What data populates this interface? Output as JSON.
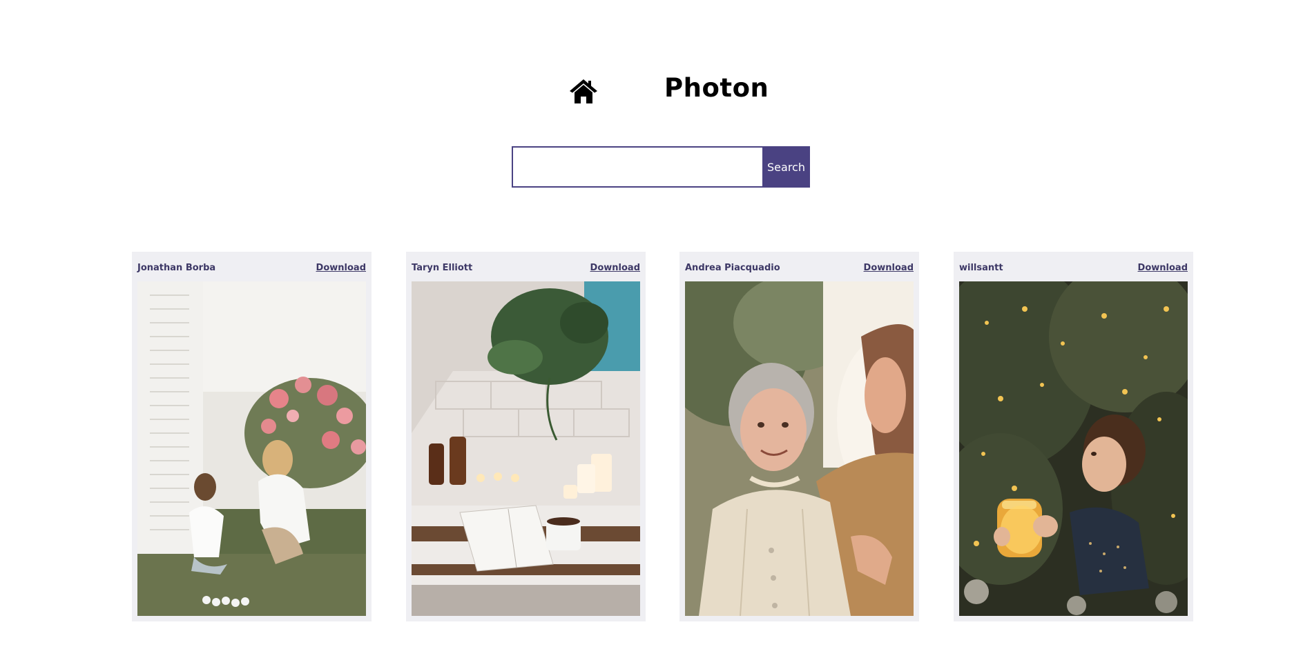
{
  "header": {
    "home_icon": "home-icon",
    "title": "Photon"
  },
  "search": {
    "value": "",
    "placeholder": "",
    "button_label": "Search"
  },
  "photos": [
    {
      "author": "Jonathan Borba",
      "download_label": "Download",
      "subject": "mother and daughter with flowers"
    },
    {
      "author": "Taryn Elliott",
      "download_label": "Download",
      "subject": "bathtub with candles, plant, book and cup"
    },
    {
      "author": "Andrea Piacquadio",
      "download_label": "Download",
      "subject": "elderly woman smiling at younger woman"
    },
    {
      "author": "willsantt",
      "download_label": "Download",
      "subject": "child holding glowing jar"
    }
  ],
  "colors": {
    "accent": "#4a4282",
    "card_bg": "#efeff3",
    "card_text": "#3d3866"
  }
}
